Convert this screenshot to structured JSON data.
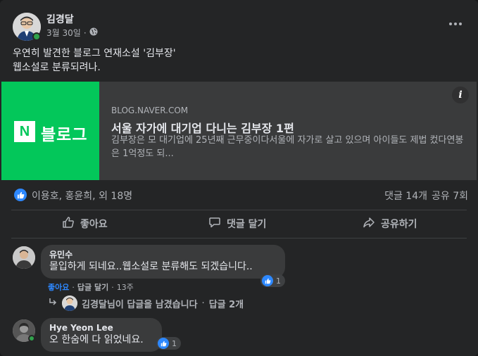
{
  "post": {
    "author": "김경달",
    "date": "3월 30일",
    "separator": "·",
    "text": "우연히 발견한 블로그 연재소설 '김부장'\n웹소설로 분류되려나."
  },
  "icons": {
    "privacy": "globe-icon",
    "more": "more-options-icon",
    "info": "info-icon",
    "like": "thumbs-up-icon",
    "comment": "comment-bubble-icon",
    "share": "share-arrow-icon",
    "reply_arrow": "reply-arrow-icon"
  },
  "preview": {
    "thumb_logo": "N",
    "thumb_label": "블로그",
    "info": "i",
    "domain": "BLOG.NAVER.COM",
    "title": "서울 자가에 대기업 다니는 김부장 1편",
    "description": "김부장은 모 대기업에 25년째 근무중이다서울에 자가로 살고 있으며 아이들도 제법 컸다연봉은 1억정도 되..."
  },
  "reactions": {
    "reactors": "이용호, 홍윤희, 외 18명",
    "comments": "댓글 14개",
    "shares": "공유 7회"
  },
  "actions": {
    "like": "좋아요",
    "comment": "댓글 달기",
    "share": "공유하기"
  },
  "comments": [
    {
      "name": "유민수",
      "text": "몰입하게 되네요..웹소설로 분류해도 되겠습니다..",
      "reaction_count": "1",
      "like": "좋아요",
      "reply": "답글 달기",
      "time": "13주",
      "dot": "·"
    },
    {
      "name": "Hye Yeon Lee",
      "text": "오 한숨에 다 읽었네요.",
      "reaction_count": "1"
    }
  ],
  "reply_summary": {
    "text": "김경달님이 답글을 남겼습니다",
    "dot": "·",
    "count": "답글 2개"
  },
  "colors": {
    "background": "#242526",
    "bubble": "#3a3b3c",
    "accent_blue": "#2d88ff",
    "naver_green": "#03c75a",
    "online_green": "#31a24c"
  }
}
